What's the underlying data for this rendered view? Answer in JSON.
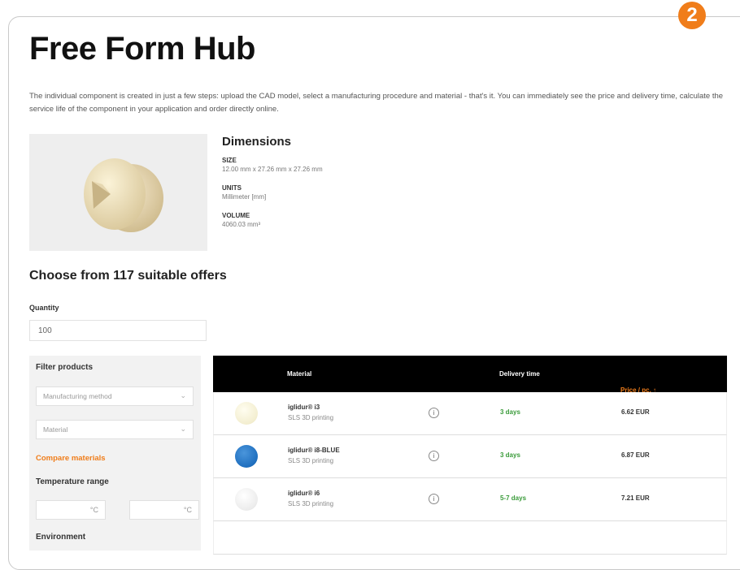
{
  "step_badge": "2",
  "title": "Free Form Hub",
  "intro": "The individual component is created in just a few steps: upload the CAD model, select a manufacturing procedure and material - that's it. You can immediately see the price and delivery time, calculate the service life of the component in your application and order directly online.",
  "dimensions": {
    "heading": "Dimensions",
    "size_label": "SIZE",
    "size_value": "12.00 mm x 27.26 mm x 27.26 mm",
    "units_label": "UNITS",
    "units_value": "Millimeter [mm]",
    "volume_label": "VOLUME",
    "volume_value": "4060.03 mm³"
  },
  "offers_title": "Choose from 117 suitable offers",
  "quantity": {
    "label": "Quantity",
    "value": "100"
  },
  "filters": {
    "title": "Filter products",
    "manufacturing_placeholder": "Manufacturing method",
    "material_placeholder": "Material",
    "compare_link": "Compare materials",
    "temperature_title": "Temperature range",
    "temp_unit_min": "°C",
    "temp_unit_max": "°C",
    "environment_title": "Environment"
  },
  "table": {
    "headers": {
      "material": "Material",
      "delivery": "Delivery time",
      "price": "Price / pc. ↑"
    },
    "rows": [
      {
        "name": "iglidur® i3",
        "process": "SLS 3D printing",
        "delivery": "3 days",
        "price": "6.62 EUR",
        "color": "#f3eed0"
      },
      {
        "name": "iglidur® i8-BLUE",
        "process": "SLS 3D printing",
        "delivery": "3 days",
        "price": "6.87 EUR",
        "color": "#1f6fbf"
      },
      {
        "name": "iglidur® i6",
        "process": "SLS 3D printing",
        "delivery": "5-7 days",
        "price": "7.21 EUR",
        "color": "#ececec"
      }
    ]
  },
  "colors": {
    "accent": "#f07d1a",
    "header_bg": "#000000",
    "delivery_green": "#3a9b3a"
  }
}
